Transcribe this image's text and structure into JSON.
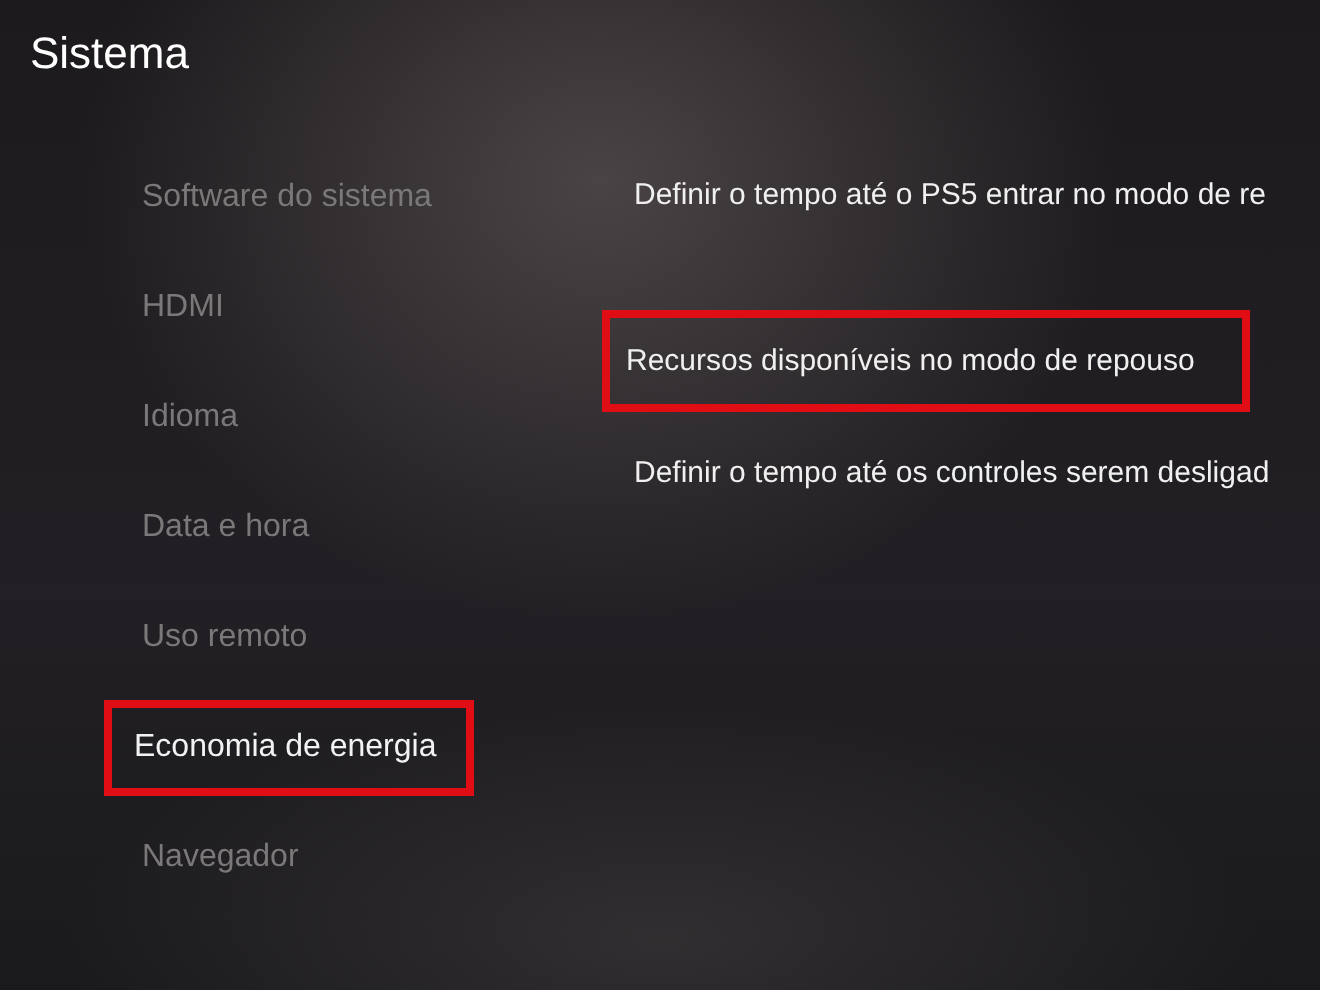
{
  "header": {
    "title": "Sistema"
  },
  "sidebar": {
    "items": [
      {
        "label": "Software do sistema",
        "selected": false,
        "highlighted": false
      },
      {
        "label": "HDMI",
        "selected": false,
        "highlighted": false
      },
      {
        "label": "Idioma",
        "selected": false,
        "highlighted": false
      },
      {
        "label": "Data e hora",
        "selected": false,
        "highlighted": false
      },
      {
        "label": "Uso remoto",
        "selected": false,
        "highlighted": false
      },
      {
        "label": "Economia de energia",
        "selected": true,
        "highlighted": true
      },
      {
        "label": "Navegador",
        "selected": false,
        "highlighted": false
      }
    ]
  },
  "options": {
    "items": [
      {
        "label": "Definir o tempo até o PS5 entrar no modo de re",
        "highlighted": false
      },
      {
        "label": "Recursos disponíveis no modo de repouso",
        "highlighted": true
      },
      {
        "label": "Definir o tempo até os controles serem desligad",
        "highlighted": false
      }
    ]
  }
}
